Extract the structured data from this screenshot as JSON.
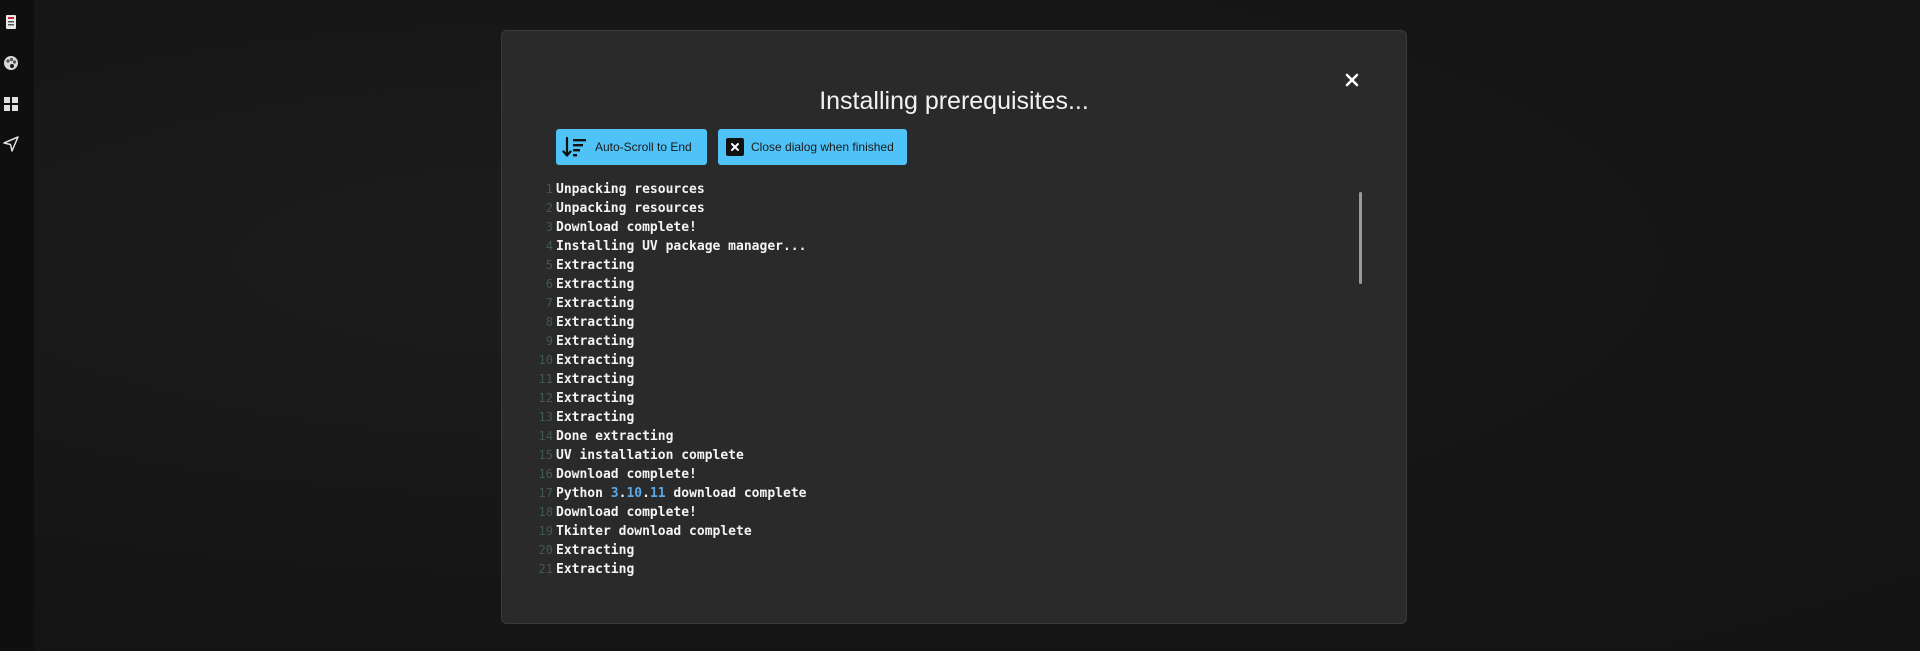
{
  "sidebar": {
    "items": [
      {
        "icon": "notebook-icon"
      },
      {
        "icon": "palette-icon"
      },
      {
        "icon": "grid-icon"
      },
      {
        "icon": "send-icon"
      }
    ]
  },
  "modal": {
    "title": "Installing prerequisites...",
    "auto_scroll_label": "Auto-Scroll to End",
    "close_when_finished_label": "Close dialog when finished"
  },
  "log": {
    "lines": [
      {
        "n": "1",
        "text": "Unpacking resources"
      },
      {
        "n": "2",
        "text": "Unpacking resources"
      },
      {
        "n": "3",
        "text": "Download complete!"
      },
      {
        "n": "4",
        "text": "Installing UV package manager..."
      },
      {
        "n": "5",
        "text": "Extracting"
      },
      {
        "n": "6",
        "text": "Extracting"
      },
      {
        "n": "7",
        "text": "Extracting"
      },
      {
        "n": "8",
        "text": "Extracting"
      },
      {
        "n": "9",
        "text": "Extracting"
      },
      {
        "n": "10",
        "text": "Extracting"
      },
      {
        "n": "11",
        "text": "Extracting"
      },
      {
        "n": "12",
        "text": "Extracting"
      },
      {
        "n": "13",
        "text": "Extracting"
      },
      {
        "n": "14",
        "text": "Done extracting"
      },
      {
        "n": "15",
        "text": "UV installation complete"
      },
      {
        "n": "16",
        "text": "Download complete!"
      },
      {
        "n": "17",
        "text": "Python 3.10.11 download complete"
      },
      {
        "n": "18",
        "text": "Download complete!"
      },
      {
        "n": "19",
        "text": "Tkinter download complete"
      },
      {
        "n": "20",
        "text": "Extracting"
      },
      {
        "n": "21",
        "text": "Extracting"
      }
    ]
  },
  "colors": {
    "accent": "#4fc3f7",
    "modal_bg": "#2a2a2a",
    "number_highlight": "#5aa9e6"
  }
}
